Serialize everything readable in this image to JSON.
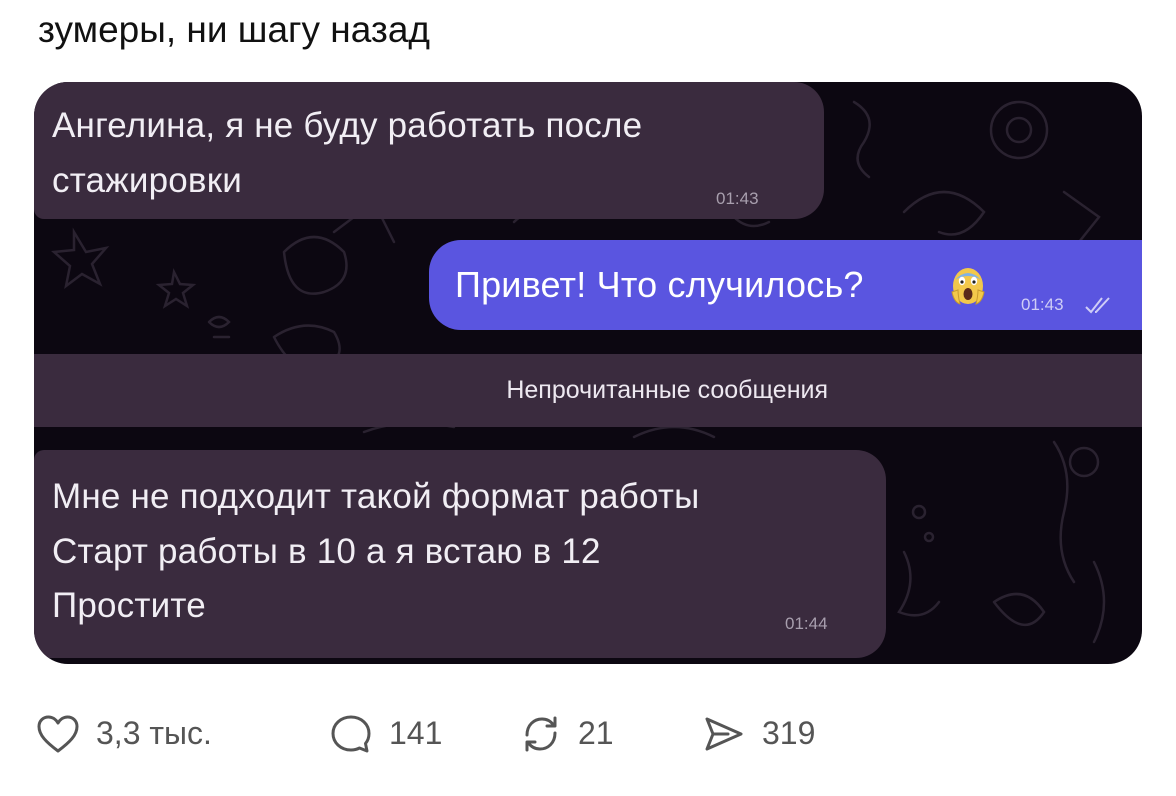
{
  "post": {
    "text": "зумеры, ни шагу назад"
  },
  "chat": {
    "messages": [
      {
        "direction": "incoming",
        "lines": [
          "Ангелина, я не буду работать после",
          "стажировки"
        ],
        "time": "01:43"
      },
      {
        "direction": "outgoing",
        "lines": [
          "Привет! Что случилось?"
        ],
        "emoji": "screaming-face-emoji",
        "time": "01:43",
        "status": "double-check-read"
      },
      {
        "direction": "incoming",
        "lines": [
          "Мне не подходит такой формат работы",
          "Старт работы в 10 а я встаю в 12",
          "Простите"
        ],
        "time": "01:44"
      }
    ],
    "unread_divider": "Непрочитанные сообщения",
    "colors": {
      "background": "#0c0711",
      "incoming_bubble": "#3a2b3e",
      "outgoing_bubble": "#5a55e0"
    }
  },
  "actions": {
    "likes": {
      "icon": "heart-icon",
      "count": "3,3 тыс."
    },
    "comments": {
      "icon": "comment-icon",
      "count": "141"
    },
    "reposts": {
      "icon": "repost-icon",
      "count": "21"
    },
    "views": {
      "icon": "views-icon",
      "count": "319"
    }
  }
}
